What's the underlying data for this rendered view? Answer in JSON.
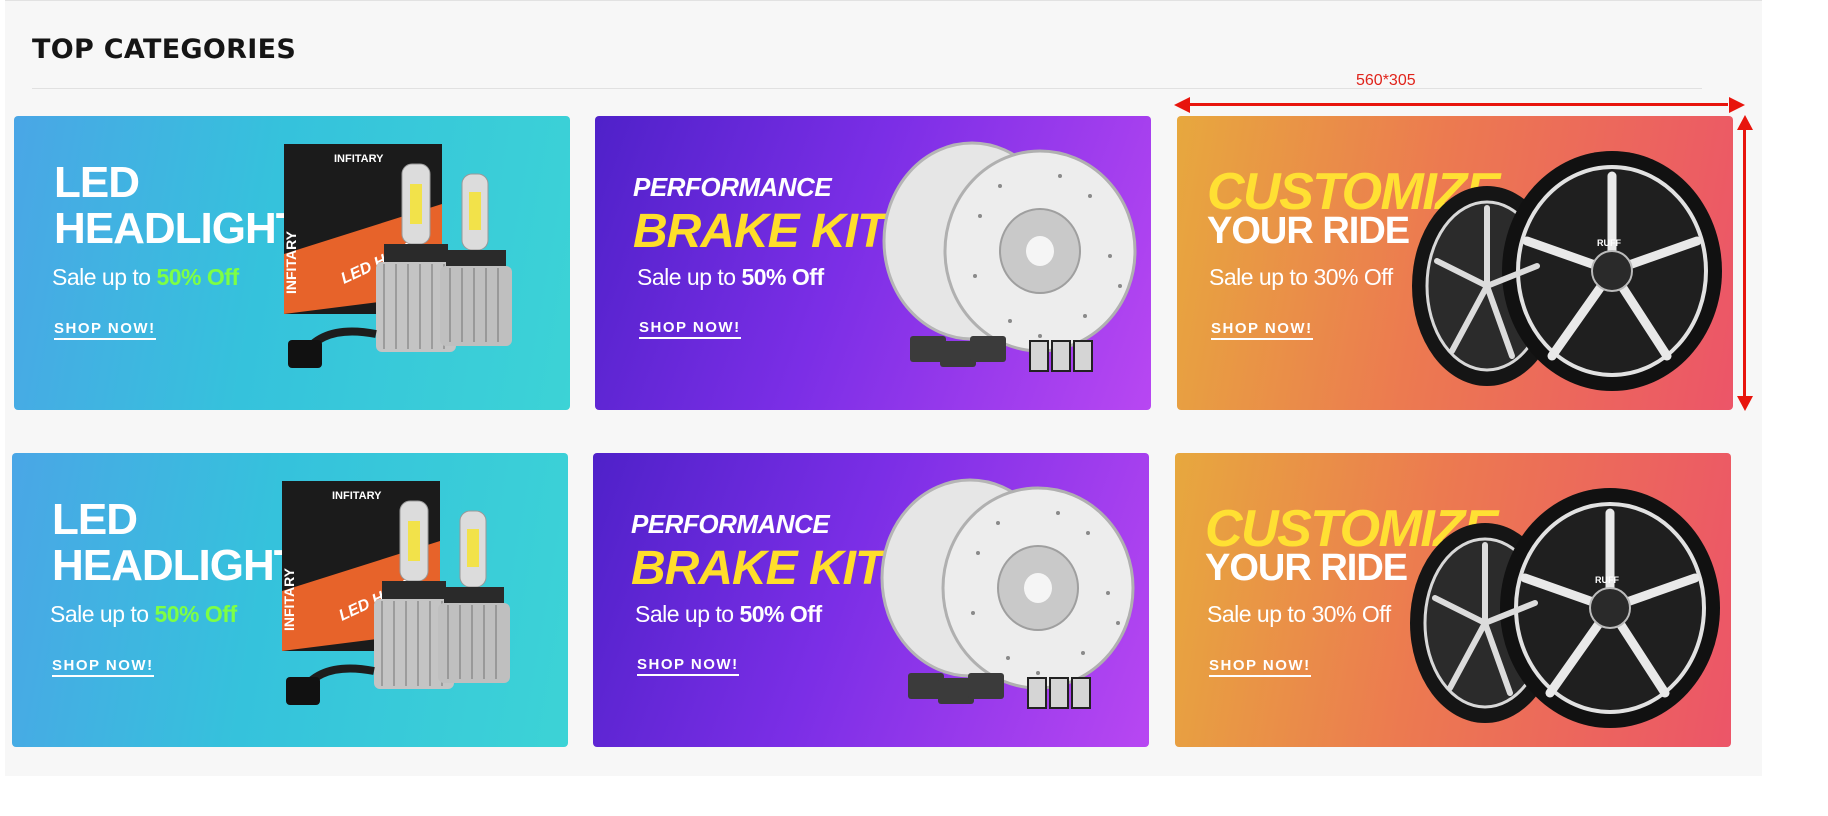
{
  "section": {
    "title": "TOP CATEGORIES"
  },
  "annotation": {
    "dimension_label": "560*305",
    "color": "#e8150d"
  },
  "banners": [
    {
      "type": "led",
      "line1": "LED",
      "line2": "HEADLIGHT",
      "sale_prefix": "Sale up to ",
      "sale_highlight": "50% Off",
      "cta": "SHOP NOW!",
      "box_brand": "INFITARY",
      "box_side": "INFITARY",
      "box_text": "LED HEAD"
    },
    {
      "type": "brake",
      "line1": "PERFORMANCE",
      "line2": "BRAKE KITS",
      "sale_prefix": "Sale up to ",
      "sale_highlight": "50% Off",
      "cta": "SHOP NOW!"
    },
    {
      "type": "custom",
      "line1": "CUSTOMIZE",
      "line2": "YOUR RIDE",
      "sale_prefix": "Sale up to 30% Off",
      "sale_highlight": "",
      "cta": "SHOP NOW!",
      "wheel_brand": "RUFF"
    },
    {
      "type": "led",
      "line1": "LED",
      "line2": "HEADLIGHT",
      "sale_prefix": "Sale up to ",
      "sale_highlight": "50% Off",
      "cta": "SHOP NOW!",
      "box_brand": "INFITARY",
      "box_side": "INFITARY",
      "box_text": "LED HEAD"
    },
    {
      "type": "brake",
      "line1": "PERFORMANCE",
      "line2": "BRAKE KITS",
      "sale_prefix": "Sale up to ",
      "sale_highlight": "50% Off",
      "cta": "SHOP NOW!"
    },
    {
      "type": "custom",
      "line1": "CUSTOMIZE",
      "line2": "YOUR RIDE",
      "sale_prefix": "Sale up to 30% Off",
      "sale_highlight": "",
      "cta": "SHOP NOW!",
      "wheel_brand": "RUFF"
    }
  ],
  "colors": {
    "led_highlight": "#7dff45",
    "brake_title": "#ffde2a",
    "custom_title": "#ffe033"
  }
}
